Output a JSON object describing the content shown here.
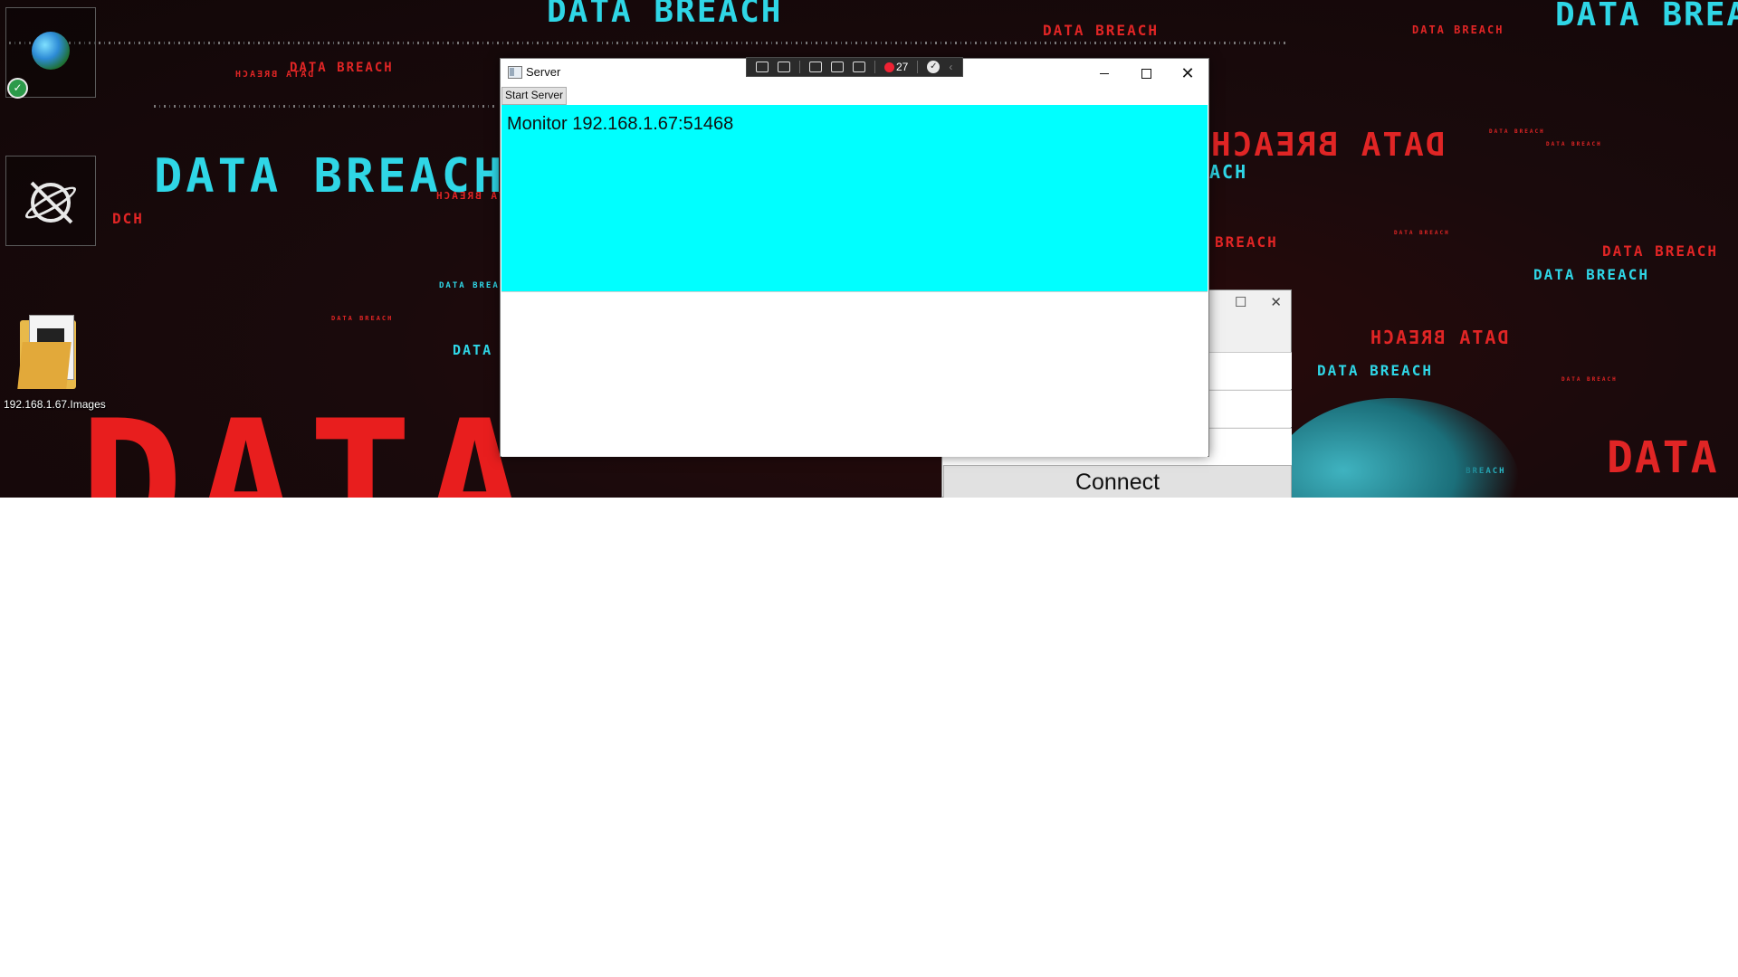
{
  "desktop": {
    "wallpaper_word": "DATA BREACH",
    "big_word": "DATA",
    "short_word": "DATA",
    "fragment_ach": "ACH",
    "fragment_dch": "DCH",
    "fragment_breach": "BREACH",
    "icons": [
      {
        "icon": "globe-icon",
        "label": ""
      },
      {
        "icon": "planet-icon",
        "label": ""
      },
      {
        "icon": "folder-icon",
        "label": "192.168.1.67.Images"
      }
    ]
  },
  "toolbar": {
    "count": "27"
  },
  "server_window": {
    "title": "Server",
    "start_button": "Start Server",
    "monitor_text": "Monitor 192.168.1.67:51468",
    "panel_color": "#00ffff"
  },
  "connect_window": {
    "connect_button": "Connect"
  }
}
